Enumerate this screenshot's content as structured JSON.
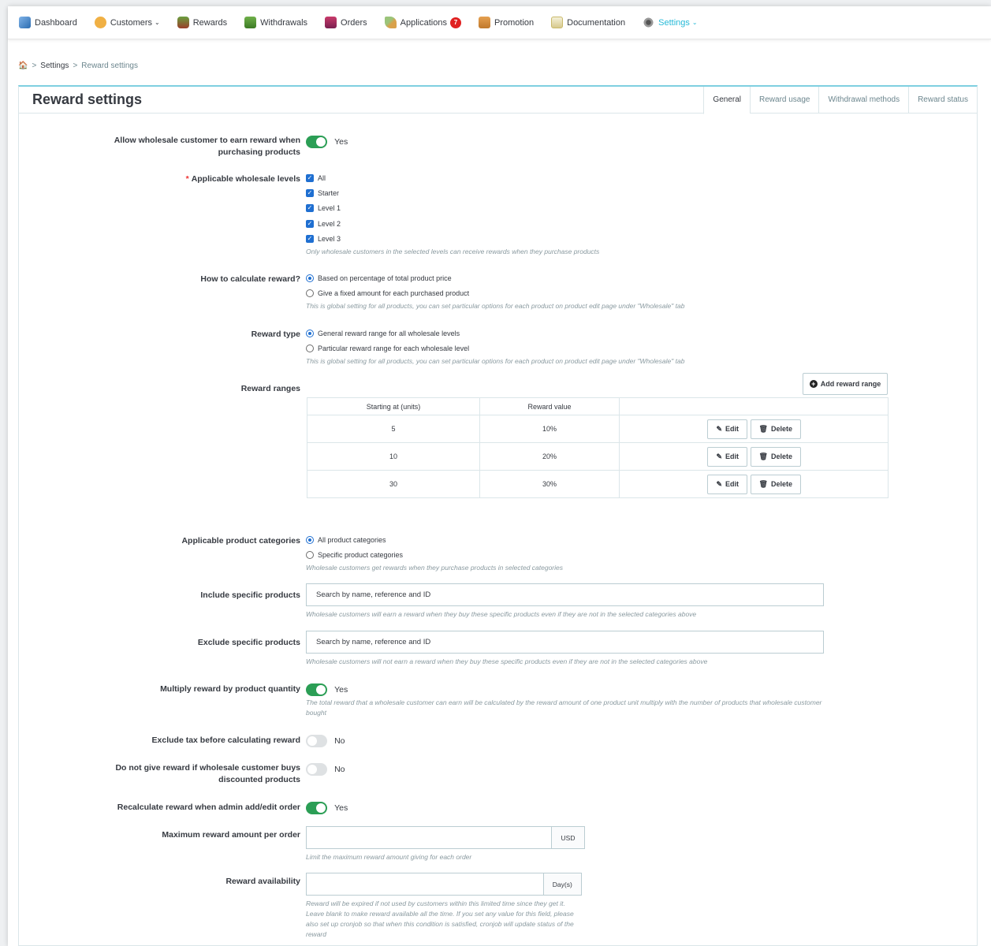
{
  "nav": [
    {
      "label": "Dashboard",
      "icon": "dashboard-icon",
      "caret": ""
    },
    {
      "label": "Customers",
      "icon": "customers-icon",
      "caret": "⌄"
    },
    {
      "label": "Rewards",
      "icon": "rewards-icon",
      "caret": ""
    },
    {
      "label": "Withdrawals",
      "icon": "withdrawals-icon",
      "caret": ""
    },
    {
      "label": "Orders",
      "icon": "orders-icon",
      "caret": ""
    },
    {
      "label": "Applications",
      "icon": "applications-icon",
      "caret": "",
      "badge": "7"
    },
    {
      "label": "Promotion",
      "icon": "promotion-icon",
      "caret": ""
    },
    {
      "label": "Documentation",
      "icon": "documentation-icon",
      "caret": ""
    },
    {
      "label": "Settings",
      "icon": "settings-icon",
      "caret": "⌄",
      "active": true
    }
  ],
  "breadcrumb": {
    "home_glyph": "🏠",
    "sep": ">",
    "settings": "Settings",
    "current": "Reward settings"
  },
  "panel": {
    "title": "Reward settings",
    "tabs": [
      "General",
      "Reward usage",
      "Withdrawal methods",
      "Reward status"
    ]
  },
  "form": {
    "allow_wholesale": {
      "label": "Allow wholesale customer to earn reward when purchasing products",
      "value": "Yes",
      "on": true
    },
    "levels": {
      "label": "Applicable wholesale levels",
      "required_mark": "*",
      "options": [
        "All",
        "Starter",
        "Level 1",
        "Level 2",
        "Level 3"
      ],
      "help": "Only wholesale customers in the selected levels can receive rewards when they purchase products"
    },
    "calc": {
      "label": "How to calculate reward?",
      "options": [
        "Based on percentage of total product price",
        "Give a fixed amount for each purchased product"
      ],
      "selected": 0,
      "help": "This is global setting for all products, you can set particular options for each product on product edit page under \"Wholesale\" tab"
    },
    "reward_type": {
      "label": "Reward type",
      "options": [
        "General reward range for all wholesale levels",
        "Particular reward range for each wholesale level"
      ],
      "selected": 0,
      "help": "This is global setting for all products, you can set particular options for each product on product edit page under \"Wholesale\" tab"
    },
    "ranges": {
      "label": "Reward ranges",
      "add_label": "Add reward range",
      "columns": [
        "Starting at (units)",
        "Reward value",
        ""
      ],
      "rows": [
        {
          "start": "5",
          "value": "10%"
        },
        {
          "start": "10",
          "value": "20%"
        },
        {
          "start": "30",
          "value": "30%"
        }
      ],
      "edit_label": "Edit",
      "delete_label": "Delete"
    },
    "categories": {
      "label": "Applicable product categories",
      "options": [
        "All product categories",
        "Specific product categories"
      ],
      "selected": 0,
      "help": "Wholesale customers get rewards when they purchase products in selected categories"
    },
    "include": {
      "label": "Include specific products",
      "placeholder": "Search by name, reference and ID",
      "help": "Wholesale customers will earn a reward when they buy these specific products even if they are not in the selected categories above"
    },
    "exclude": {
      "label": "Exclude specific products",
      "placeholder": "Search by name, reference and ID",
      "help": "Wholesale customers will not earn a reward when they buy these specific products even if they are not in the selected categories above"
    },
    "multiply": {
      "label": "Multiply reward by product quantity",
      "value": "Yes",
      "on": true,
      "help": "The total reward that a wholesale customer can earn will be calculated by the reward amount of one product unit multiply with the number of products that wholesale customer bought"
    },
    "exclude_tax": {
      "label": "Exclude tax before calculating reward",
      "value": "No",
      "on": false
    },
    "discounted": {
      "label": "Do not give reward if wholesale customer buys discounted products",
      "value": "No",
      "on": false
    },
    "recalculate": {
      "label": "Recalculate reward when admin add/edit order",
      "value": "Yes",
      "on": true
    },
    "max_amount": {
      "label": "Maximum reward amount per order",
      "value": "",
      "unit": "USD",
      "help": "Limit the maximum reward amount giving for each order"
    },
    "availability": {
      "label": "Reward availability",
      "value": "",
      "unit": "Day(s)",
      "help": "Reward will be expired if not used by customers within this limited time since they get it. Leave blank to make reward available all the time. If you set any value for this field, please also set up cronjob so that when this condition is satisfied, cronjob will update status of the reward"
    }
  },
  "colors": {
    "accent": "#25b9d7",
    "switch_on": "#2b9e55",
    "checkbox": "#1f6fd1"
  }
}
